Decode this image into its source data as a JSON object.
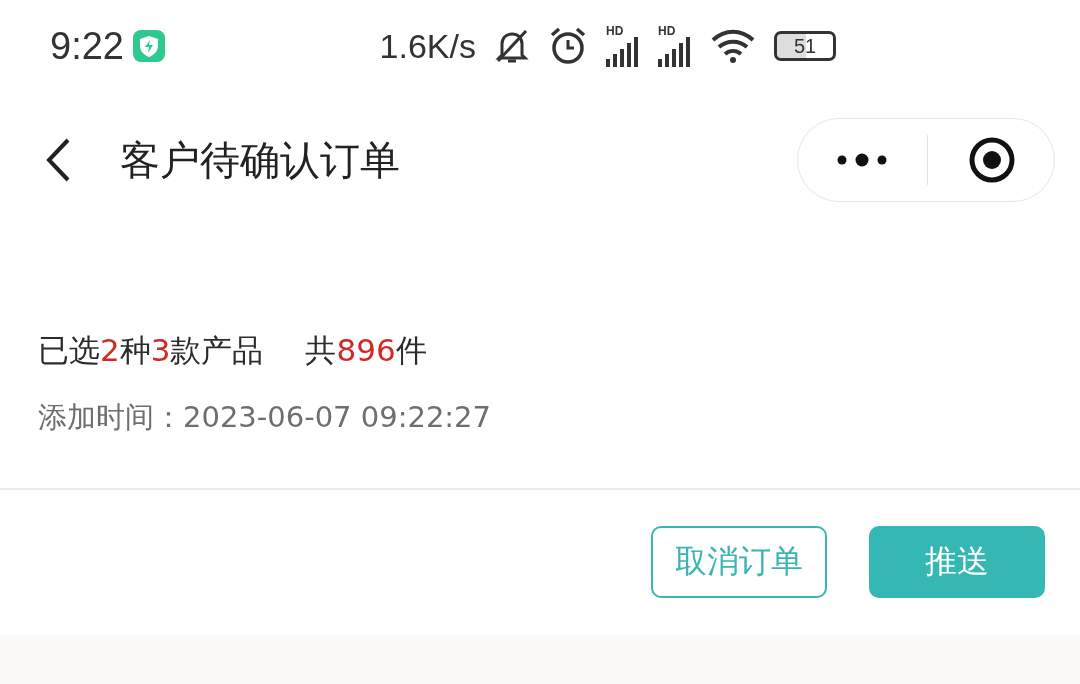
{
  "status_bar": {
    "time": "9:22",
    "net_speed": "1.6K/s",
    "signal_labels": [
      "HD",
      "HD"
    ],
    "battery": "51"
  },
  "nav": {
    "title": "客户待确认订单"
  },
  "order": {
    "summary": [
      {
        "text": "已选",
        "highlight": false
      },
      {
        "text": "2",
        "highlight": true
      },
      {
        "text": "种",
        "highlight": false
      },
      {
        "text": "3",
        "highlight": true
      },
      {
        "text": "款产品",
        "highlight": false
      }
    ],
    "total": [
      {
        "text": "共",
        "highlight": false
      },
      {
        "text": "896",
        "highlight": true
      },
      {
        "text": "件",
        "highlight": false
      }
    ],
    "added_time": "添加时间：2023-06-07 09:22:27"
  },
  "buttons": [
    {
      "label": "取消订单",
      "kind": "outline"
    },
    {
      "label": "推送",
      "kind": "primary"
    }
  ]
}
